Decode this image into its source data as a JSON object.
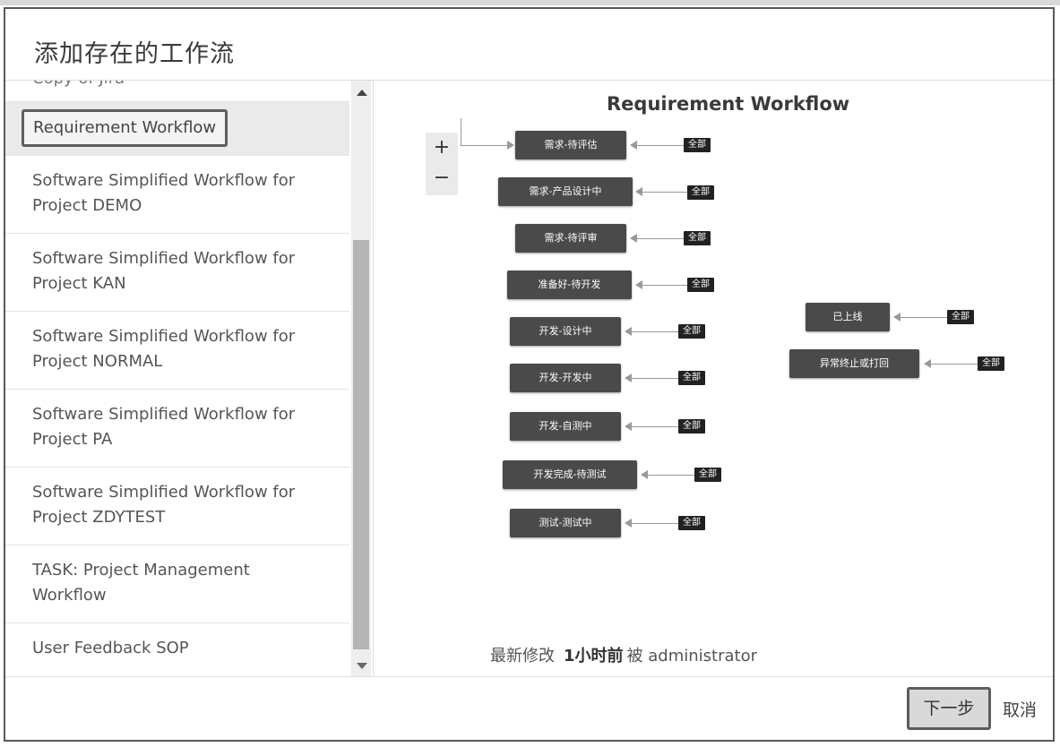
{
  "dialog": {
    "title": "添加存在的工作流"
  },
  "workflow_list": {
    "partial_item": "Copy of Jira",
    "selected_item": "Requirement Workflow",
    "items": [
      {
        "line1": "Software Simplified Workflow for",
        "line2": "Project DEMO"
      },
      {
        "line1": "Software Simplified Workflow for",
        "line2": "Project KAN"
      },
      {
        "line1": "Software Simplified Workflow for",
        "line2": "Project NORMAL"
      },
      {
        "line1": "Software Simplified Workflow for",
        "line2": "Project PA"
      },
      {
        "line1": "Software Simplified Workflow for",
        "line2": "Project ZDYTEST"
      },
      {
        "line1": "TASK: Project Management",
        "line2": "Workflow"
      },
      {
        "line1": "User Feedback SOP",
        "line2": ""
      }
    ]
  },
  "preview": {
    "title": "Requirement Workflow",
    "zoom_in": "+",
    "zoom_out": "−",
    "status_nodes": [
      "需求-待评估",
      "需求-产品设计中",
      "需求-待评审",
      "准备好-待开发",
      "开发-设计中",
      "开发-开发中",
      "开发-自测中",
      "开发完成-待测试",
      "测试-测试中",
      "已上线",
      "异常终止或打回"
    ],
    "transition_tag": "全部",
    "modified_label": "最新修改",
    "modified_time": "1小时前",
    "modified_by_word": "被",
    "modified_user": "administrator"
  },
  "footer": {
    "next_label": "下一步",
    "cancel_label": "取消"
  }
}
